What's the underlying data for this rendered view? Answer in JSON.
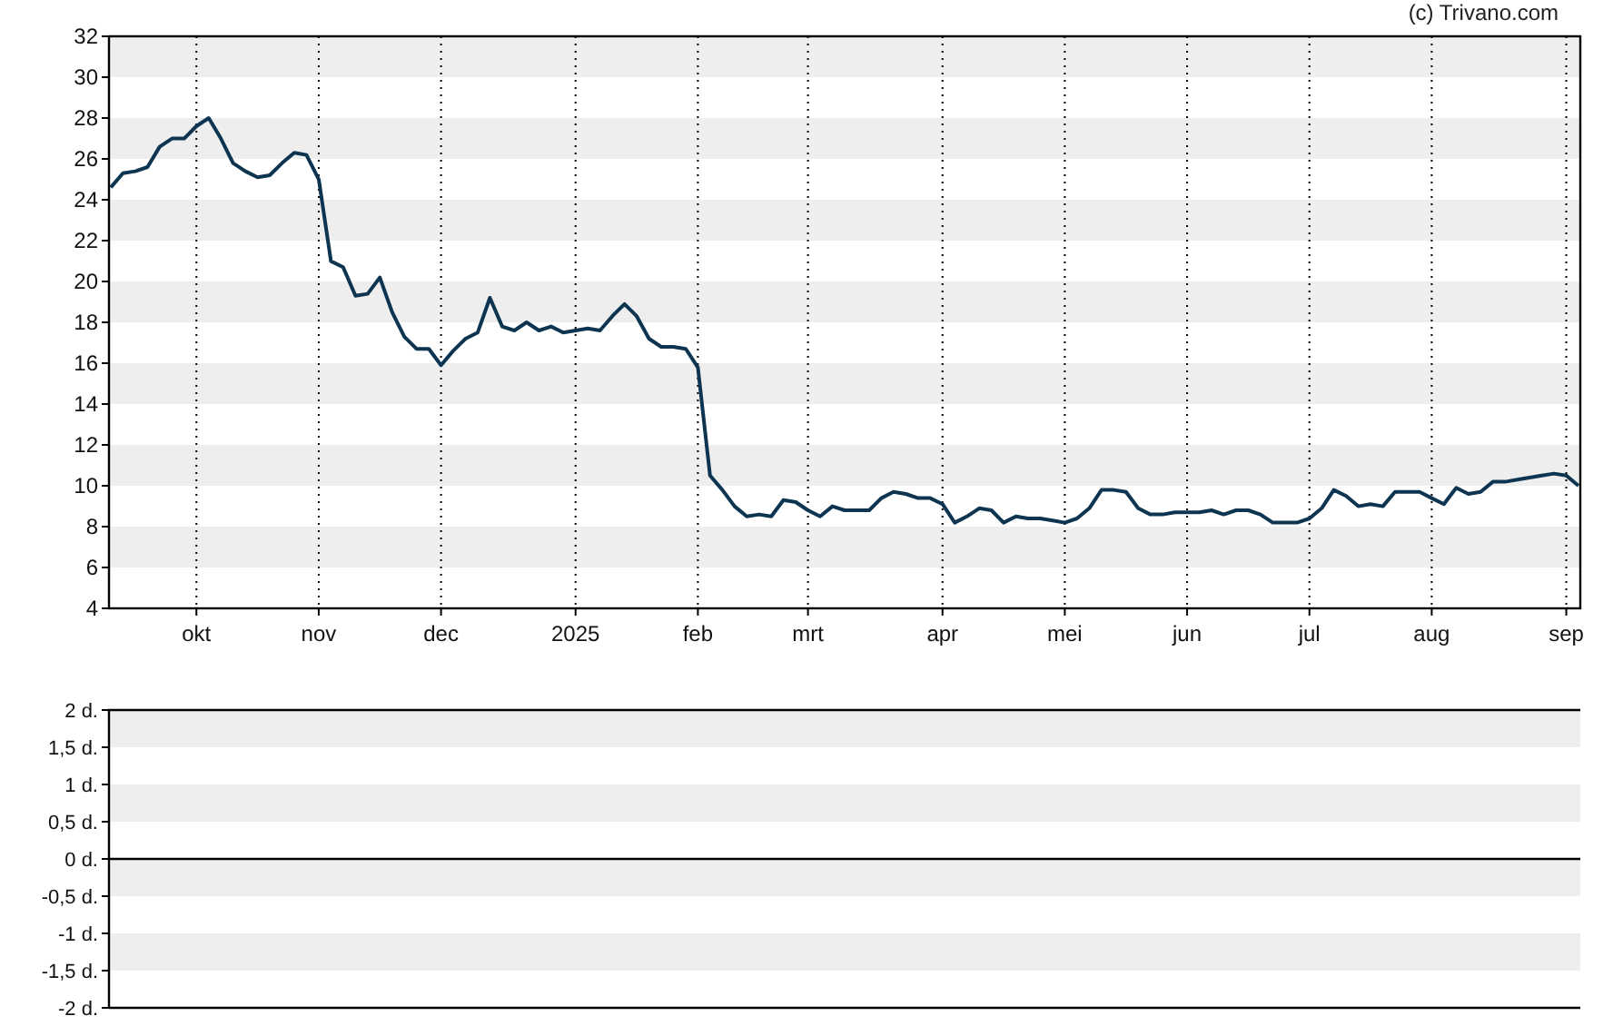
{
  "credit": "(c) Trivano.com",
  "price_chart": {
    "chart_data": {
      "type": "line",
      "grid": true,
      "ylim": [
        4,
        32
      ],
      "yticks": [
        4,
        6,
        8,
        10,
        12,
        14,
        16,
        18,
        20,
        22,
        24,
        26,
        28,
        30,
        32
      ],
      "categories": [
        null,
        null,
        null,
        null,
        null,
        null,
        null,
        "okt",
        null,
        null,
        null,
        null,
        null,
        null,
        null,
        null,
        null,
        "nov",
        null,
        null,
        null,
        null,
        null,
        null,
        null,
        null,
        null,
        "dec",
        null,
        null,
        null,
        null,
        null,
        null,
        null,
        null,
        null,
        null,
        "2025",
        null,
        null,
        null,
        null,
        null,
        null,
        null,
        null,
        null,
        "feb",
        null,
        null,
        null,
        null,
        null,
        null,
        null,
        null,
        "mrt",
        null,
        null,
        null,
        null,
        null,
        null,
        null,
        null,
        null,
        null,
        "apr",
        null,
        null,
        null,
        null,
        null,
        null,
        null,
        null,
        null,
        "mei",
        null,
        null,
        null,
        null,
        null,
        null,
        null,
        null,
        null,
        "jun",
        null,
        null,
        null,
        null,
        null,
        null,
        null,
        null,
        null,
        "jul",
        null,
        null,
        null,
        null,
        null,
        null,
        null,
        null,
        null,
        "aug",
        null,
        null,
        null,
        null,
        null,
        null,
        null,
        null,
        null,
        null,
        "sep",
        null
      ],
      "series": [
        {
          "color": "#0d3450",
          "values": [
            24.6,
            25.3,
            25.4,
            25.6,
            26.6,
            27.0,
            27.0,
            27.6,
            28.0,
            27.0,
            25.8,
            25.4,
            25.1,
            25.2,
            25.8,
            26.3,
            26.2,
            25.0,
            21.0,
            20.7,
            19.3,
            19.4,
            20.2,
            18.5,
            17.3,
            16.7,
            16.7,
            15.9,
            16.6,
            17.2,
            17.5,
            19.2,
            17.8,
            17.6,
            18.0,
            17.6,
            17.8,
            17.5,
            17.6,
            17.7,
            17.6,
            18.3,
            18.9,
            18.3,
            17.2,
            16.8,
            16.8,
            16.7,
            15.8,
            10.5,
            9.8,
            9.0,
            8.5,
            8.6,
            8.5,
            9.3,
            9.2,
            8.8,
            8.5,
            9.0,
            8.8,
            8.8,
            8.8,
            9.4,
            9.7,
            9.6,
            9.4,
            9.4,
            9.1,
            8.2,
            8.5,
            8.9,
            8.8,
            8.2,
            8.5,
            8.4,
            8.4,
            8.3,
            8.2,
            8.4,
            8.9,
            9.8,
            9.8,
            9.7,
            8.9,
            8.6,
            8.6,
            8.7,
            8.7,
            8.7,
            8.8,
            8.6,
            8.8,
            8.8,
            8.6,
            8.2,
            8.2,
            8.2,
            8.4,
            8.9,
            9.8,
            9.5,
            9.0,
            9.1,
            9.0,
            9.7,
            9.7,
            9.7,
            9.4,
            9.1,
            9.9,
            9.6,
            9.7,
            10.2,
            10.2,
            10.3,
            10.4,
            10.5,
            10.6,
            10.5,
            10.0
          ]
        }
      ]
    }
  },
  "days_panel": {
    "axis_labels": [
      "2 d.",
      "1,5 d.",
      "1 d.",
      "0,5 d.",
      "0 d.",
      "-0,5 d.",
      "-1 d.",
      "-1,5 d.",
      "-2 d."
    ]
  }
}
